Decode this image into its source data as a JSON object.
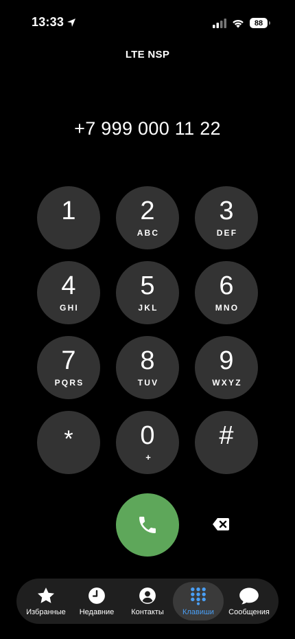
{
  "status_bar": {
    "time": "13:33",
    "battery": "88"
  },
  "carrier": "LTE NSP",
  "dialed_number": "+7 999 000 11 22",
  "keypad": [
    {
      "digit": "1",
      "letters": ""
    },
    {
      "digit": "2",
      "letters": "ABC"
    },
    {
      "digit": "3",
      "letters": "DEF"
    },
    {
      "digit": "4",
      "letters": "GHI"
    },
    {
      "digit": "5",
      "letters": "JKL"
    },
    {
      "digit": "6",
      "letters": "MNO"
    },
    {
      "digit": "7",
      "letters": "PQRS"
    },
    {
      "digit": "8",
      "letters": "TUV"
    },
    {
      "digit": "9",
      "letters": "WXYZ"
    },
    {
      "digit": "*",
      "letters": ""
    },
    {
      "digit": "0",
      "letters": "+"
    },
    {
      "digit": "#",
      "letters": ""
    }
  ],
  "tabs": [
    {
      "label": "Избранные",
      "icon": "star-icon"
    },
    {
      "label": "Недавние",
      "icon": "clock-icon"
    },
    {
      "label": "Контакты",
      "icon": "person-icon"
    },
    {
      "label": "Клавиши",
      "icon": "keypad-icon",
      "active": true
    },
    {
      "label": "Сообщения",
      "icon": "speech-bubble-icon"
    }
  ],
  "colors": {
    "key_background": "#333333",
    "call_green": "#5ea75a",
    "active_tab_accent": "#4a9ff5",
    "tab_bar_background": "#1f1f1f"
  }
}
